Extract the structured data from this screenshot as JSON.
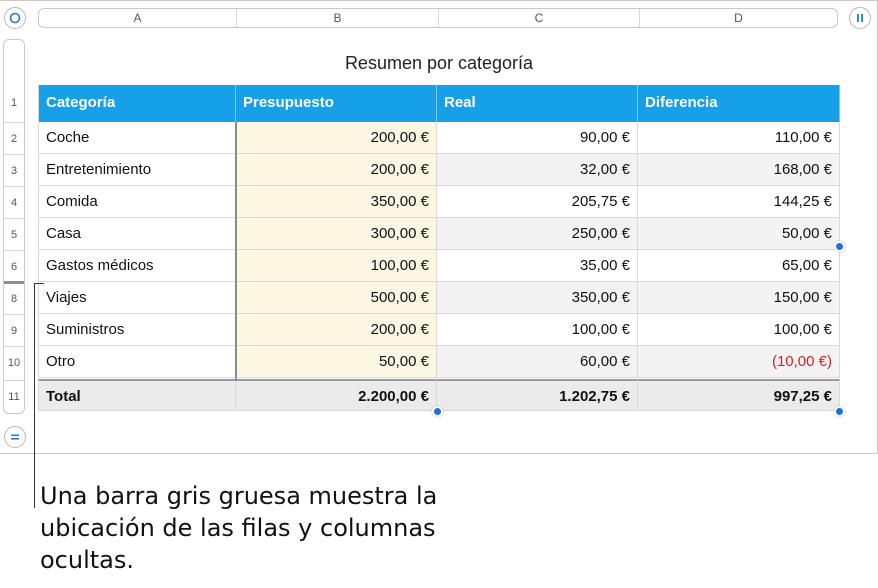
{
  "columns": [
    "A",
    "B",
    "C",
    "D"
  ],
  "row_numbers": [
    "1",
    "2",
    "3",
    "4",
    "5",
    "6",
    "8",
    "9",
    "10",
    "11"
  ],
  "title": "Resumen por categoría",
  "header": {
    "category": "Categoría",
    "budget": "Presupuesto",
    "real": "Real",
    "difference": "Diferencia"
  },
  "rows": [
    {
      "category": "Coche",
      "budget": "200,00 €",
      "real": "90,00 €",
      "difference": "110,00 €"
    },
    {
      "category": "Entretenimiento",
      "budget": "200,00 €",
      "real": "32,00 €",
      "difference": "168,00 €"
    },
    {
      "category": "Comida",
      "budget": "350,00 €",
      "real": "205,75 €",
      "difference": "144,25 €"
    },
    {
      "category": "Casa",
      "budget": "300,00 €",
      "real": "250,00 €",
      "difference": "50,00 €"
    },
    {
      "category": "Gastos médicos",
      "budget": "100,00 €",
      "real": "35,00 €",
      "difference": "65,00 €"
    },
    {
      "category": "Viajes",
      "budget": "500,00 €",
      "real": "350,00 €",
      "difference": "150,00 €"
    },
    {
      "category": "Suministros",
      "budget": "200,00 €",
      "real": "100,00 €",
      "difference": "100,00 €"
    },
    {
      "category": "Otro",
      "budget": "50,00 €",
      "real": "60,00 €",
      "difference": "(10,00 €)"
    }
  ],
  "total": {
    "category": "Total",
    "budget": "2.200,00 €",
    "real": "1.202,75 €",
    "difference": "997,25 €"
  },
  "callout": "Una barra gris gruesa muestra la ubicación de las filas y columnas ocultas.",
  "colors": {
    "header_bg": "#16a0ea",
    "budget_bg": "#fbf7e3",
    "negative": "#e02020",
    "handle": "#1f6fdc"
  }
}
